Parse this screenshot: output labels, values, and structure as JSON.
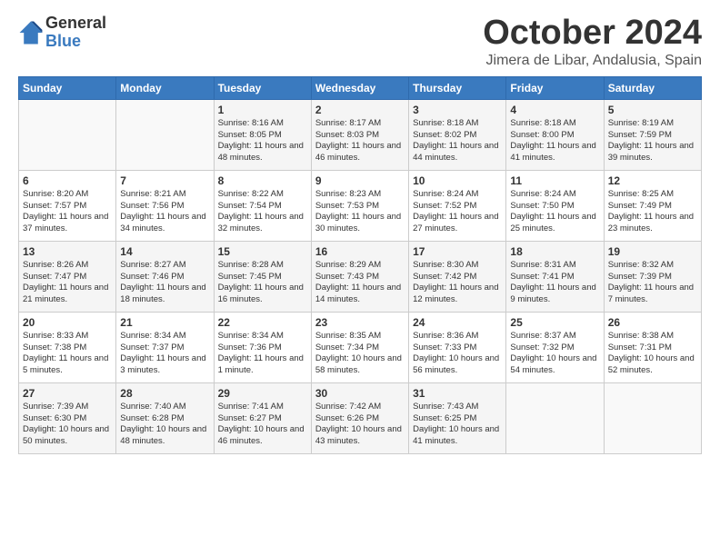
{
  "logo": {
    "general": "General",
    "blue": "Blue"
  },
  "header": {
    "month": "October 2024",
    "location": "Jimera de Libar, Andalusia, Spain"
  },
  "days_of_week": [
    "Sunday",
    "Monday",
    "Tuesday",
    "Wednesday",
    "Thursday",
    "Friday",
    "Saturday"
  ],
  "weeks": [
    [
      {
        "day": "",
        "data": ""
      },
      {
        "day": "",
        "data": ""
      },
      {
        "day": "1",
        "data": "Sunrise: 8:16 AM\nSunset: 8:05 PM\nDaylight: 11 hours and 48 minutes."
      },
      {
        "day": "2",
        "data": "Sunrise: 8:17 AM\nSunset: 8:03 PM\nDaylight: 11 hours and 46 minutes."
      },
      {
        "day": "3",
        "data": "Sunrise: 8:18 AM\nSunset: 8:02 PM\nDaylight: 11 hours and 44 minutes."
      },
      {
        "day": "4",
        "data": "Sunrise: 8:18 AM\nSunset: 8:00 PM\nDaylight: 11 hours and 41 minutes."
      },
      {
        "day": "5",
        "data": "Sunrise: 8:19 AM\nSunset: 7:59 PM\nDaylight: 11 hours and 39 minutes."
      }
    ],
    [
      {
        "day": "6",
        "data": "Sunrise: 8:20 AM\nSunset: 7:57 PM\nDaylight: 11 hours and 37 minutes."
      },
      {
        "day": "7",
        "data": "Sunrise: 8:21 AM\nSunset: 7:56 PM\nDaylight: 11 hours and 34 minutes."
      },
      {
        "day": "8",
        "data": "Sunrise: 8:22 AM\nSunset: 7:54 PM\nDaylight: 11 hours and 32 minutes."
      },
      {
        "day": "9",
        "data": "Sunrise: 8:23 AM\nSunset: 7:53 PM\nDaylight: 11 hours and 30 minutes."
      },
      {
        "day": "10",
        "data": "Sunrise: 8:24 AM\nSunset: 7:52 PM\nDaylight: 11 hours and 27 minutes."
      },
      {
        "day": "11",
        "data": "Sunrise: 8:24 AM\nSunset: 7:50 PM\nDaylight: 11 hours and 25 minutes."
      },
      {
        "day": "12",
        "data": "Sunrise: 8:25 AM\nSunset: 7:49 PM\nDaylight: 11 hours and 23 minutes."
      }
    ],
    [
      {
        "day": "13",
        "data": "Sunrise: 8:26 AM\nSunset: 7:47 PM\nDaylight: 11 hours and 21 minutes."
      },
      {
        "day": "14",
        "data": "Sunrise: 8:27 AM\nSunset: 7:46 PM\nDaylight: 11 hours and 18 minutes."
      },
      {
        "day": "15",
        "data": "Sunrise: 8:28 AM\nSunset: 7:45 PM\nDaylight: 11 hours and 16 minutes."
      },
      {
        "day": "16",
        "data": "Sunrise: 8:29 AM\nSunset: 7:43 PM\nDaylight: 11 hours and 14 minutes."
      },
      {
        "day": "17",
        "data": "Sunrise: 8:30 AM\nSunset: 7:42 PM\nDaylight: 11 hours and 12 minutes."
      },
      {
        "day": "18",
        "data": "Sunrise: 8:31 AM\nSunset: 7:41 PM\nDaylight: 11 hours and 9 minutes."
      },
      {
        "day": "19",
        "data": "Sunrise: 8:32 AM\nSunset: 7:39 PM\nDaylight: 11 hours and 7 minutes."
      }
    ],
    [
      {
        "day": "20",
        "data": "Sunrise: 8:33 AM\nSunset: 7:38 PM\nDaylight: 11 hours and 5 minutes."
      },
      {
        "day": "21",
        "data": "Sunrise: 8:34 AM\nSunset: 7:37 PM\nDaylight: 11 hours and 3 minutes."
      },
      {
        "day": "22",
        "data": "Sunrise: 8:34 AM\nSunset: 7:36 PM\nDaylight: 11 hours and 1 minute."
      },
      {
        "day": "23",
        "data": "Sunrise: 8:35 AM\nSunset: 7:34 PM\nDaylight: 10 hours and 58 minutes."
      },
      {
        "day": "24",
        "data": "Sunrise: 8:36 AM\nSunset: 7:33 PM\nDaylight: 10 hours and 56 minutes."
      },
      {
        "day": "25",
        "data": "Sunrise: 8:37 AM\nSunset: 7:32 PM\nDaylight: 10 hours and 54 minutes."
      },
      {
        "day": "26",
        "data": "Sunrise: 8:38 AM\nSunset: 7:31 PM\nDaylight: 10 hours and 52 minutes."
      }
    ],
    [
      {
        "day": "27",
        "data": "Sunrise: 7:39 AM\nSunset: 6:30 PM\nDaylight: 10 hours and 50 minutes."
      },
      {
        "day": "28",
        "data": "Sunrise: 7:40 AM\nSunset: 6:28 PM\nDaylight: 10 hours and 48 minutes."
      },
      {
        "day": "29",
        "data": "Sunrise: 7:41 AM\nSunset: 6:27 PM\nDaylight: 10 hours and 46 minutes."
      },
      {
        "day": "30",
        "data": "Sunrise: 7:42 AM\nSunset: 6:26 PM\nDaylight: 10 hours and 43 minutes."
      },
      {
        "day": "31",
        "data": "Sunrise: 7:43 AM\nSunset: 6:25 PM\nDaylight: 10 hours and 41 minutes."
      },
      {
        "day": "",
        "data": ""
      },
      {
        "day": "",
        "data": ""
      }
    ]
  ]
}
